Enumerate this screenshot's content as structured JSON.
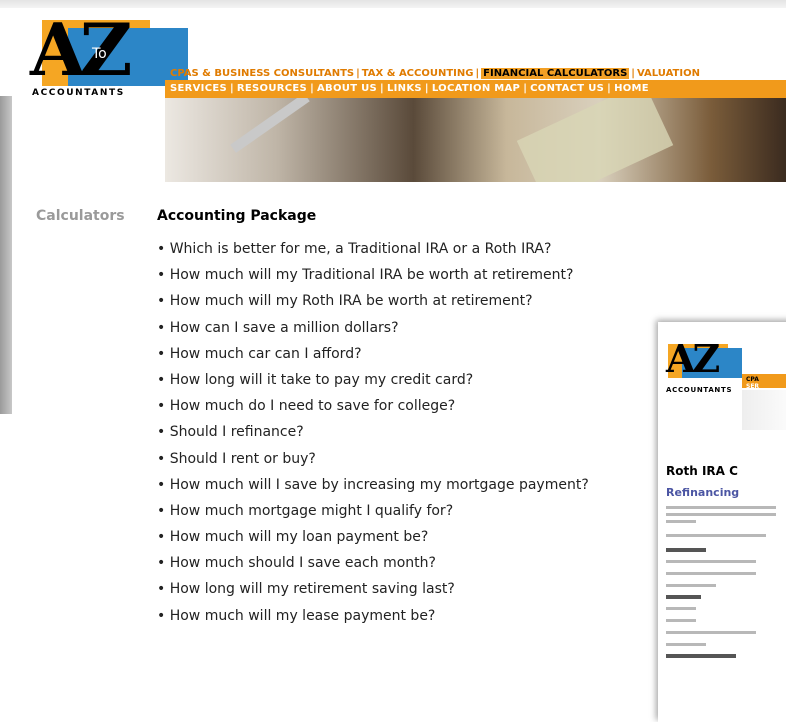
{
  "header": {
    "logo_to": "To",
    "logo_word": "ACCOUNTANTS",
    "nav_top": [
      {
        "label": "CPAS & BUSINESS CONSULTANTS",
        "highlight": false
      },
      {
        "label": "TAX & ACCOUNTING",
        "highlight": false
      },
      {
        "label": "FINANCIAL CALCULATORS",
        "highlight": true
      },
      {
        "label": "VALUATION",
        "highlight": false
      }
    ],
    "nav_bottom": [
      "SERVICES",
      "RESOURCES",
      "ABOUT US",
      "LINKS",
      "LOCATION MAP",
      "CONTACT US",
      "HOME"
    ]
  },
  "main": {
    "side_label": "Calculators",
    "title": "Accounting Package",
    "items": [
      "• Which is better for me, a Traditional IRA or a Roth IRA?",
      "• How much will my Traditional IRA be worth at retirement?",
      "• How much will my Roth IRA be worth at retirement?",
      "• How can I save a million dollars?",
      "• How much car can I afford?",
      "• How long will it take to pay my credit card?",
      "• How much do I need to save for college?",
      "• Should I refinance?",
      "• Should I rent or buy?",
      "• How much will I save by increasing my mortgage payment?",
      "• How much mortgage might I qualify for?",
      "• How much will my loan payment be?",
      "• How much should I save each month?",
      "• How long will my retirement saving last?",
      "• How much will my lease payment be?"
    ]
  },
  "preview": {
    "logo_word": "ACCOUNTANTS",
    "nav_cpa": "CPA",
    "nav_ser": "SER",
    "title": "Roth IRA C",
    "subtitle": "Refinancing"
  },
  "colors": {
    "accent_orange": "#f19a1b",
    "logo_blue": "#2c86c7",
    "subtitle_blue": "#4b55a3"
  }
}
